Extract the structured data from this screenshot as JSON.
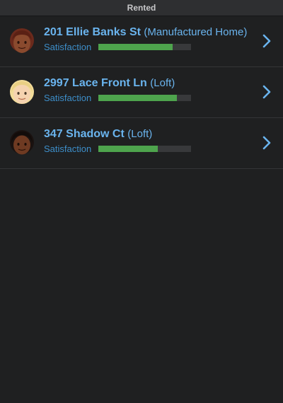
{
  "header": {
    "title": "Rented"
  },
  "colors": {
    "accent": "#6ab4ee",
    "bar_fill": "#4ea44d",
    "bar_track": "#38393b",
    "background": "#1f2021"
  },
  "rows": [
    {
      "street": "201 Ellie Banks St",
      "type": "(Manufactured Home)",
      "satisfaction_label": "Satisfaction",
      "satisfaction": 0.8,
      "avatar": "tenant-avatar-dark-curly-hair"
    },
    {
      "street": "2997 Lace Front Ln",
      "type": "(Loft)",
      "satisfaction_label": "Satisfaction",
      "satisfaction": 0.85,
      "avatar": "tenant-avatar-blonde-hair"
    },
    {
      "street": "347 Shadow Ct",
      "type": "(Loft)",
      "satisfaction_label": "Satisfaction",
      "satisfaction": 0.64,
      "avatar": "tenant-avatar-dark-hair"
    }
  ]
}
